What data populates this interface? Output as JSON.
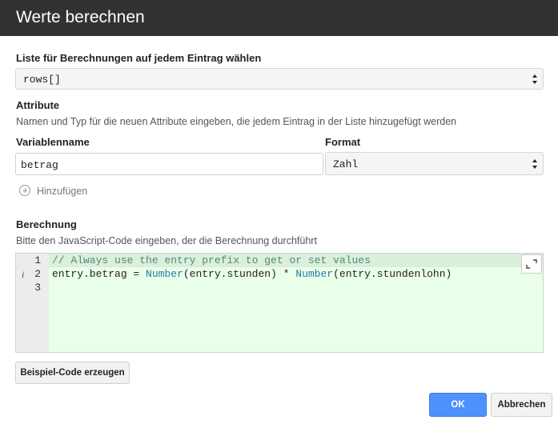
{
  "dialog": {
    "title": "Werte berechnen"
  },
  "list_select": {
    "label": "Liste für Berechnungen auf jedem Eintrag wählen",
    "value": "rows[]"
  },
  "attributes": {
    "heading": "Attribute",
    "hint": "Namen und Typ für die neuen Attribute eingeben, die jedem Eintrag in der Liste hinzugefügt werden",
    "name_header": "Variablenname",
    "format_header": "Format",
    "rows": [
      {
        "name": "betrag",
        "format": "Zahl"
      }
    ],
    "add_label": "Hinzufügen"
  },
  "calculation": {
    "heading": "Berechnung",
    "hint": "Bitte den JavaScript-Code eingeben, der die Berechnung durchführt",
    "line_numbers": [
      "1",
      "2",
      "3"
    ],
    "info_marker": "i",
    "code": {
      "line1": "// Always use the entry prefix to get or set values",
      "line2_a": "entry.betrag = ",
      "line2_fn1": "Number",
      "line2_b": "(entry.stunden) * ",
      "line2_fn2": "Number",
      "line2_c": "(entry.stundenlohn)"
    },
    "expand_icon": "expand-icon"
  },
  "buttons": {
    "example_code": "Beispiel-Code erzeugen",
    "ok": "OK",
    "cancel": "Abbrechen"
  },
  "colors": {
    "titlebar": "#323232",
    "primary": "#4d90fe",
    "editor_bg": "#eaffea",
    "comment": "#4f8a7a",
    "function": "#2a7ba6"
  }
}
